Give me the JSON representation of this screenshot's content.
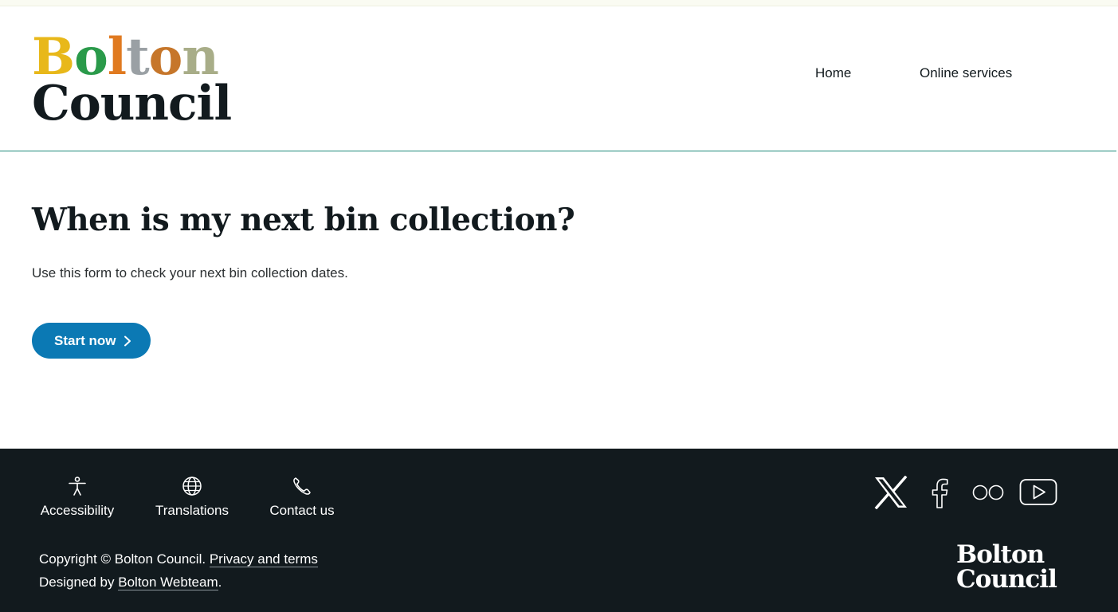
{
  "header": {
    "logo": {
      "word1": "Bolton",
      "word2": "Council",
      "letter_colors": [
        "#e8b81a",
        "#2a9a4a",
        "#e07a20",
        "#9aa0a4",
        "#c6762a",
        "#a8ad88"
      ]
    },
    "nav": {
      "home": "Home",
      "online_services": "Online services"
    }
  },
  "main": {
    "title": "When is my next bin collection?",
    "intro": "Use this form to check your next bin collection dates.",
    "start_button": "Start now"
  },
  "footer": {
    "links": {
      "accessibility": "Accessibility",
      "translations": "Translations",
      "contact": "Contact us"
    },
    "copyright_prefix": "Copyright © Bolton Council.",
    "privacy_link": "Privacy and terms",
    "designed_prefix": "Designed by",
    "webteam_link": "Bolton Webteam",
    "designed_suffix": ".",
    "logo_word1": "Bolton",
    "logo_word2": "Council",
    "social_icons": [
      "x-icon",
      "facebook-icon",
      "flickr-icon",
      "youtube-icon"
    ]
  },
  "colors": {
    "accent": "#0b79b4",
    "footer_bg": "#121a1e",
    "header_rule": "#1f8a7a"
  }
}
